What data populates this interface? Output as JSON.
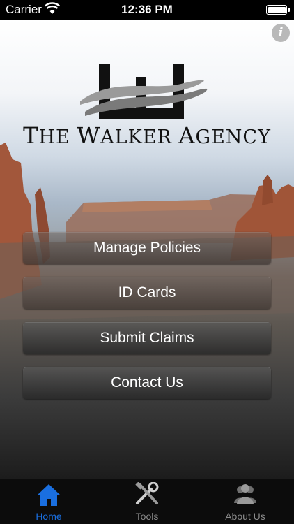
{
  "status_bar": {
    "carrier": "Carrier",
    "time": "12:36 PM"
  },
  "header": {
    "info_icon": "i",
    "agency_name": "The Walker Agency"
  },
  "menu": [
    {
      "label": "Manage Policies"
    },
    {
      "label": "ID Cards"
    },
    {
      "label": "Submit Claims"
    },
    {
      "label": "Contact Us"
    }
  ],
  "tabbar": {
    "items": [
      {
        "label": "Home",
        "icon": "home-icon",
        "active": true
      },
      {
        "label": "Tools",
        "icon": "tools-icon",
        "active": false
      },
      {
        "label": "About Us",
        "icon": "people-icon",
        "active": false
      }
    ],
    "active_color": "#1a6fe0"
  }
}
